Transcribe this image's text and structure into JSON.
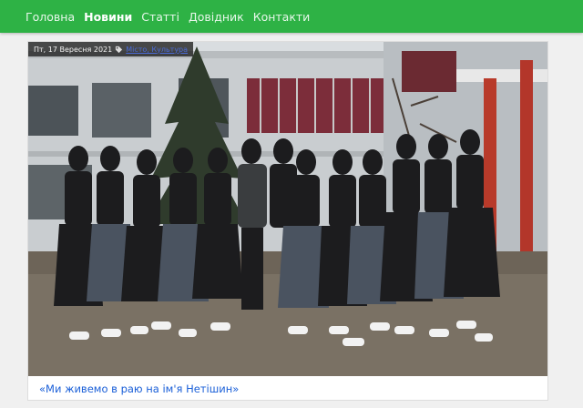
{
  "nav": {
    "items": [
      {
        "label": "Головна",
        "active": false
      },
      {
        "label": "Новини",
        "active": true
      },
      {
        "label": "Статті",
        "active": false
      },
      {
        "label": "Довідник",
        "active": false
      },
      {
        "label": "Контакти",
        "active": false
      }
    ]
  },
  "article": {
    "date": "Пт, 17 Вересня 2021",
    "category": "Місто, Культура",
    "title": "«Ми живемо в раю на ім'я Нетішин»",
    "tag_icon": "tag-icon"
  },
  "colors": {
    "header_green": "#2eb245",
    "link_blue": "#1a5fd8"
  }
}
